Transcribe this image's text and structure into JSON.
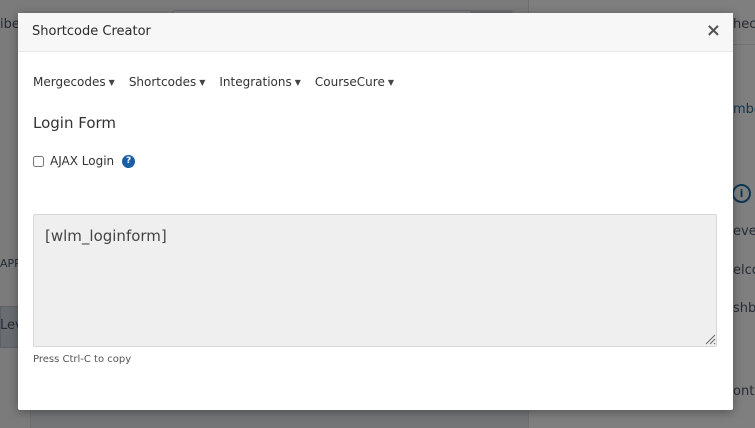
{
  "background": {
    "left_fragment": "ibers",
    "right_top_fragment": "heck",
    "right_link_fragment": "mber",
    "right_item_1": "evel",
    "right_item_2": "elco",
    "right_item_3": "shbo",
    "right_item_4": "ontent",
    "left_apply": "APP",
    "left_level": "Leve"
  },
  "modal": {
    "title": "Shortcode Creator",
    "close_label": "×",
    "menu": [
      {
        "label": "Mergecodes"
      },
      {
        "label": "Shortcodes"
      },
      {
        "label": "Integrations"
      },
      {
        "label": "CourseCure"
      }
    ],
    "section_title": "Login Form",
    "ajax_login_label": "AJAX Login",
    "ajax_login_checked": false,
    "help_icon": "question-circle-icon",
    "shortcode_value": "[wlm_loginform]",
    "copy_hint": "Press Ctrl-C to copy"
  }
}
